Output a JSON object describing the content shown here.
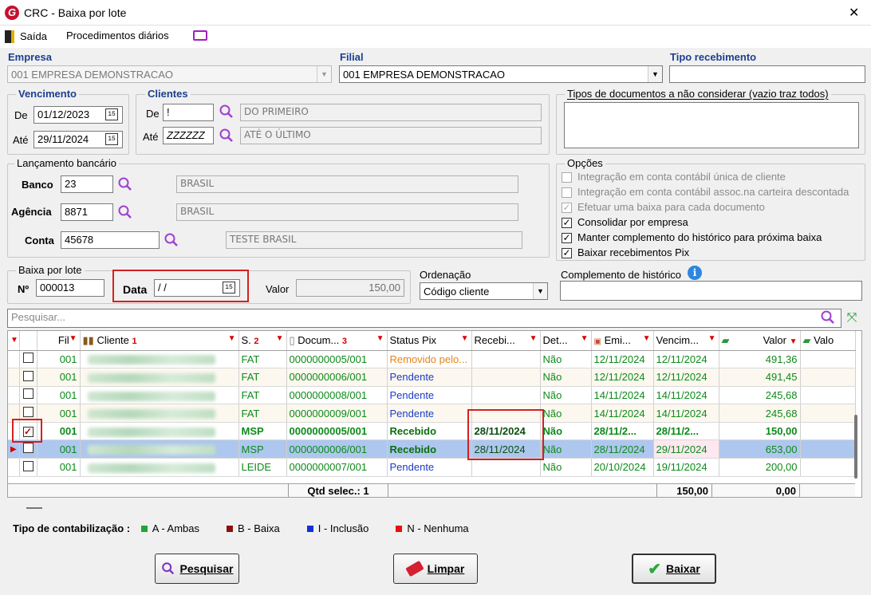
{
  "window": {
    "title": "CRC - Baixa por lote",
    "close": "✕"
  },
  "menu": {
    "exit": "Saída",
    "daily": "Procedimentos diários"
  },
  "empresa": {
    "label": "Empresa",
    "value": "001 EMPRESA DEMONSTRACAO"
  },
  "filial": {
    "label": "Filial",
    "value": "001 EMPRESA DEMONSTRACAO"
  },
  "tipo_recebimento": {
    "label": "Tipo recebimento",
    "value": ""
  },
  "vencimento": {
    "title": "Vencimento",
    "de_label": "De",
    "de": "01/12/2023",
    "ate_label": "Até",
    "ate": "29/11/2024"
  },
  "clientes": {
    "title": "Clientes",
    "de_label": "De",
    "de": "!",
    "de_name": "DO PRIMEIRO",
    "ate_label": "Até",
    "ate": "ZZZZZZ",
    "ate_name": "ATÉ O ÚLTIMO"
  },
  "tipos_docs": {
    "label": "Tipos de documentos a não considerar (vazio traz todos)"
  },
  "lancamento": {
    "title": "Lançamento bancário",
    "banco_label": "Banco",
    "banco": "23",
    "banco_name": "BRASIL",
    "agencia_label": "Agência",
    "agencia": "8871",
    "agencia_name": "BRASIL",
    "conta_label": "Conta",
    "conta": "45678",
    "conta_name": "TESTE BRASIL"
  },
  "opcoes": {
    "title": "Opções",
    "items": [
      {
        "label": "Integração em conta contábil única de cliente",
        "checked": false,
        "enabled": false
      },
      {
        "label": "Integração em conta contábil assoc.na carteira descontada",
        "checked": false,
        "enabled": false
      },
      {
        "label": "Efetuar uma baixa para cada documento",
        "checked": true,
        "enabled": false
      },
      {
        "label": "Consolidar por empresa",
        "checked": true,
        "enabled": true
      },
      {
        "label": "Manter complemento do histórico para próxima baixa",
        "checked": true,
        "enabled": true
      },
      {
        "label": "Baixar recebimentos Pix",
        "checked": true,
        "enabled": true
      }
    ]
  },
  "baixa": {
    "title": "Baixa por lote",
    "n_label": "Nº",
    "n": "000013",
    "data_label": "Data",
    "data": " /  /",
    "valor_label": "Valor",
    "valor": "150,00"
  },
  "ordenacao": {
    "label": "Ordenação",
    "value": "Código cliente"
  },
  "complemento": {
    "label": "Complemento de histórico",
    "value": ""
  },
  "search": {
    "placeholder": "Pesquisar..."
  },
  "grid": {
    "headers": {
      "fil": "Fil",
      "cliente": "Cliente",
      "cliente_n": "1",
      "s": "S.",
      "s_n": "2",
      "doc": "Docum...",
      "doc_n": "3",
      "status": "Status Pix",
      "receb": "Recebi...",
      "det": "Det...",
      "emi": "Emi...",
      "venc": "Vencim...",
      "valor": "Valor",
      "valo": "Valo"
    },
    "rows": [
      {
        "fil": "001",
        "s": "FAT",
        "doc": "0000000005/001",
        "status": "Removido pelo...",
        "status_color": "#e8831a",
        "receb": "",
        "det": "Não",
        "emi": "12/11/2024",
        "venc": "12/11/2024",
        "valor": "491,36",
        "checked": false
      },
      {
        "fil": "001",
        "s": "FAT",
        "doc": "0000000006/001",
        "status": "Pendente",
        "status_color": "#1a3cc8",
        "receb": "",
        "det": "Não",
        "emi": "12/11/2024",
        "venc": "12/11/2024",
        "valor": "491,45",
        "checked": false
      },
      {
        "fil": "001",
        "s": "FAT",
        "doc": "0000000008/001",
        "status": "Pendente",
        "status_color": "#1a3cc8",
        "receb": "",
        "det": "Não",
        "emi": "14/11/2024",
        "venc": "14/11/2024",
        "valor": "245,68",
        "checked": false
      },
      {
        "fil": "001",
        "s": "FAT",
        "doc": "0000000009/001",
        "status": "Pendente",
        "status_color": "#1a3cc8",
        "receb": "",
        "det": "Não",
        "emi": "14/11/2024",
        "venc": "14/11/2024",
        "valor": "245,68",
        "checked": false
      },
      {
        "fil": "001",
        "s": "MSP",
        "doc": "0000000005/001",
        "status": "Recebido",
        "status_color": "#0a6e10",
        "receb": "28/11/2024",
        "det": "Não",
        "emi": "28/11/2...",
        "venc": "28/11/2...",
        "valor": "150,00",
        "checked": true
      },
      {
        "fil": "001",
        "s": "MSP",
        "doc": "0000000006/001",
        "status": "Recebido",
        "status_color": "#0a6e10",
        "receb": "28/11/2024",
        "det": "Não",
        "emi": "28/11/2024",
        "venc": "29/11/2024",
        "valor": "653,00",
        "checked": false
      },
      {
        "fil": "001",
        "s": "LEIDE",
        "doc": "0000000007/001",
        "status": "Pendente",
        "status_color": "#1a3cc8",
        "receb": "",
        "det": "Não",
        "emi": "20/10/2024",
        "venc": "19/11/2024",
        "valor": "200,00",
        "checked": false
      }
    ],
    "footer": {
      "qtd": "Qtd selec.: 1",
      "sum1": "150,00",
      "sum2": "0,00"
    }
  },
  "legenda": {
    "label": "Tipo de contabilização :",
    "items": [
      {
        "label": "A - Ambas",
        "color": "#1fa53a"
      },
      {
        "label": "B - Baixa",
        "color": "#8b1010"
      },
      {
        "label": "I - Inclusão",
        "color": "#1030d8"
      },
      {
        "label": "N - Nenhuma",
        "color": "#e81010"
      }
    ]
  },
  "buttons": {
    "pesquisar": "Pesquisar",
    "limpar": "Limpar",
    "baixar": "Baixar"
  }
}
